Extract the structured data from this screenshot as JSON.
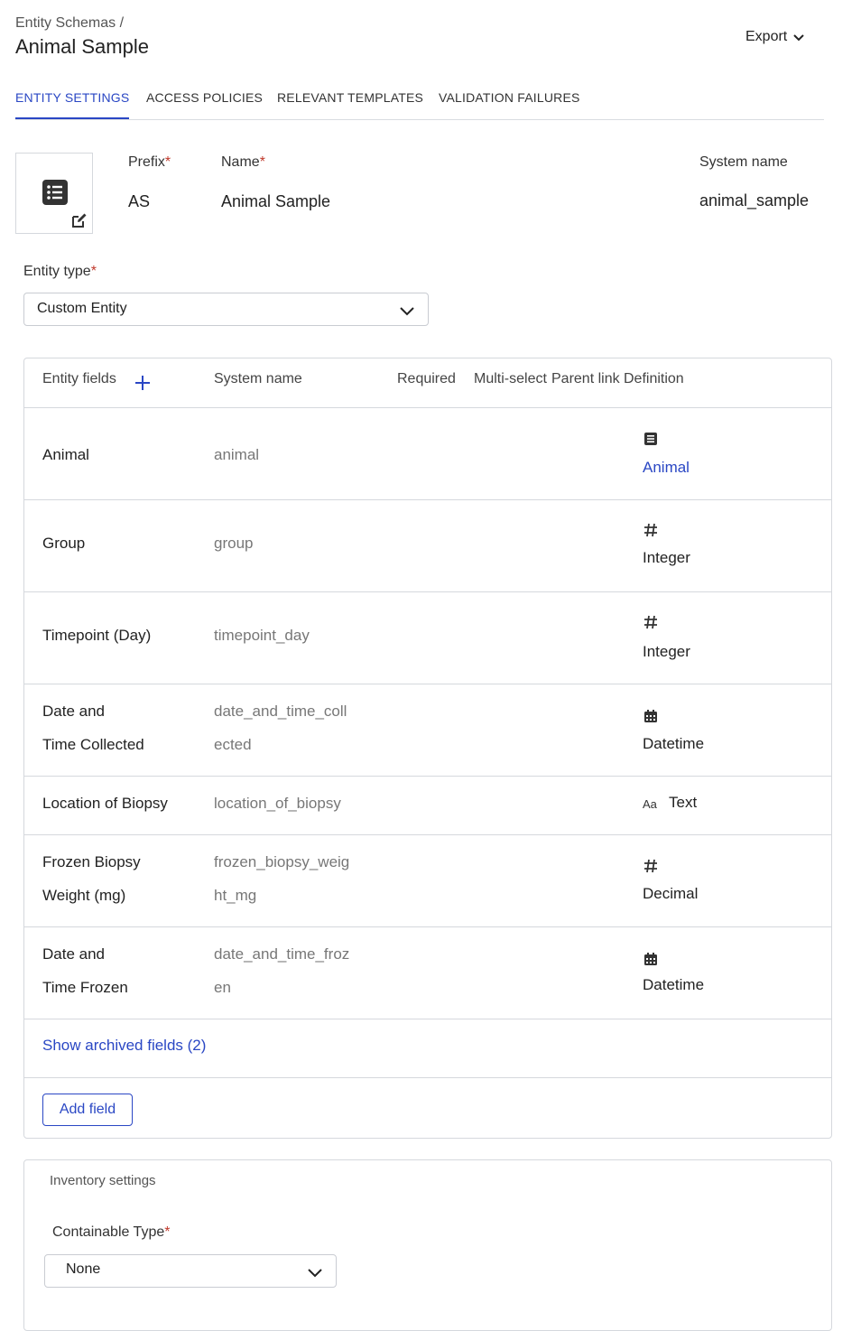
{
  "breadcrumb": "Entity Schemas /",
  "page_title": "Animal Sample",
  "export_label": "Export",
  "tabs": [
    "ENTITY SETTINGS",
    "ACCESS POLICIES",
    "RELEVANT TEMPLATES",
    "VALIDATION FAILURES"
  ],
  "active_tab": "ENTITY SETTINGS",
  "header_fields": {
    "prefix_label": "Prefix",
    "prefix_value": "AS",
    "name_label": "Name",
    "name_value": "Animal Sample",
    "system_name_label": "System name",
    "system_name_value": "animal_sample",
    "required_mark": "*"
  },
  "entity_type": {
    "label": "Entity type",
    "value": "Custom Entity"
  },
  "fields_table": {
    "headers": {
      "entity_fields": "Entity fields",
      "system_name": "System name",
      "required": "Required",
      "multi_select": "Multi-select",
      "parent_link": "Parent link",
      "definition": "Definition"
    },
    "rows": [
      {
        "name": [
          "Animal"
        ],
        "system": [
          "animal"
        ],
        "icon": "entity-list-icon",
        "definition": "Animal",
        "is_link": true
      },
      {
        "name": [
          "Group"
        ],
        "system": [
          "group"
        ],
        "icon": "hash-icon",
        "definition": "Integer",
        "is_link": false
      },
      {
        "name": [
          "Timepoint (Day)"
        ],
        "system": [
          "timepoint_day"
        ],
        "icon": "hash-icon",
        "definition": "Integer",
        "is_link": false
      },
      {
        "name": [
          "Date and",
          "Time Collected"
        ],
        "system": [
          "date_and_time_coll",
          "ected"
        ],
        "icon": "calendar-icon",
        "definition": "Datetime",
        "is_link": false
      },
      {
        "name": [
          "Location of Biopsy"
        ],
        "system": [
          "location_of_biopsy"
        ],
        "icon": "text-aa-icon",
        "definition": "Text",
        "is_link": false
      },
      {
        "name": [
          "Frozen Biopsy",
          "Weight (mg)"
        ],
        "system": [
          "frozen_biopsy_weig",
          "ht_mg"
        ],
        "icon": "hash-icon",
        "definition": "Decimal",
        "is_link": false
      },
      {
        "name": [
          "Date and",
          "Time Frozen"
        ],
        "system": [
          "date_and_time_froz",
          "en"
        ],
        "icon": "calendar-icon",
        "definition": "Datetime",
        "is_link": false
      }
    ],
    "show_archived": "Show archived fields (2)",
    "add_field": "Add field",
    "text_icon_glyph": "Aa"
  },
  "inventory": {
    "title": "Inventory settings",
    "containable_label": "Containable Type",
    "containable_value": "None"
  },
  "colors": {
    "accent": "#2a47c4",
    "required": "#c0392b",
    "border": "#d5d8dd"
  }
}
